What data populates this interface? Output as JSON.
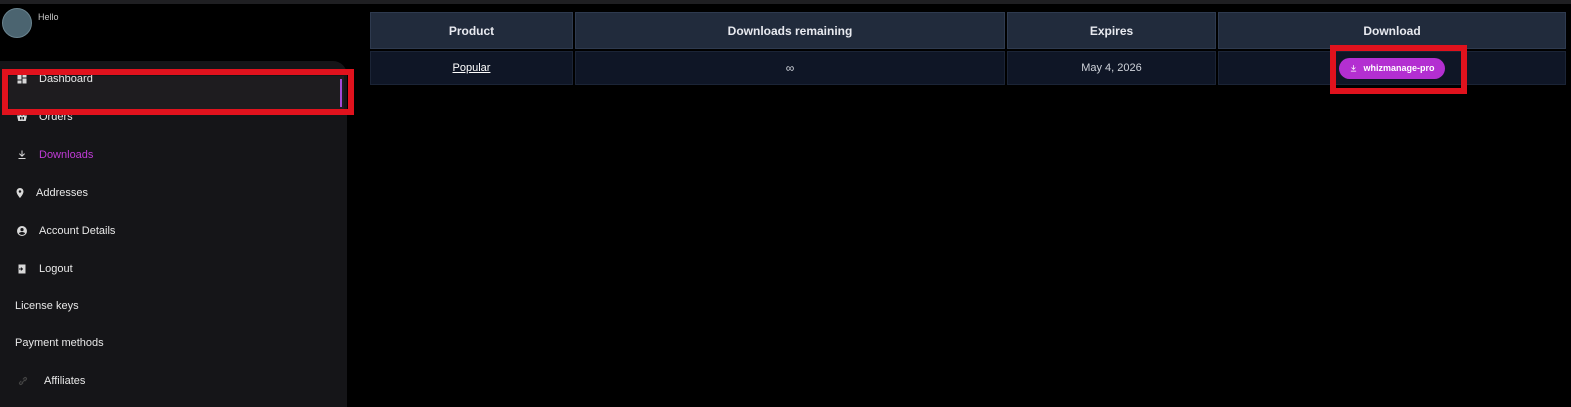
{
  "user": {
    "greeting": "Hello"
  },
  "nav": {
    "items": [
      {
        "label": "Dashboard",
        "icon": "dashboard-icon"
      },
      {
        "label": "Orders",
        "icon": "basket-icon"
      },
      {
        "label": "Downloads",
        "icon": "download-icon",
        "active": true
      },
      {
        "label": "Addresses",
        "icon": "location-pin-icon"
      },
      {
        "label": "Account Details",
        "icon": "user-circle-icon"
      },
      {
        "label": "Logout",
        "icon": "logout-icon"
      },
      {
        "label": "License keys"
      },
      {
        "label": "Payment methods"
      },
      {
        "label": "Affiliates",
        "icon": "link-icon"
      }
    ]
  },
  "downloads_table": {
    "headers": [
      "Product",
      "Downloads remaining",
      "Expires",
      "Download"
    ],
    "rows": [
      {
        "product": "Popular",
        "remaining": "∞",
        "expires": "May 4, 2026",
        "download_label": "whizmanage-pro"
      }
    ]
  },
  "colors": {
    "accent": "#c13bd8",
    "button": "#b32fd1",
    "highlight": "#e0121d",
    "header_cell": "#212b3c",
    "body_cell": "#0f1626"
  }
}
